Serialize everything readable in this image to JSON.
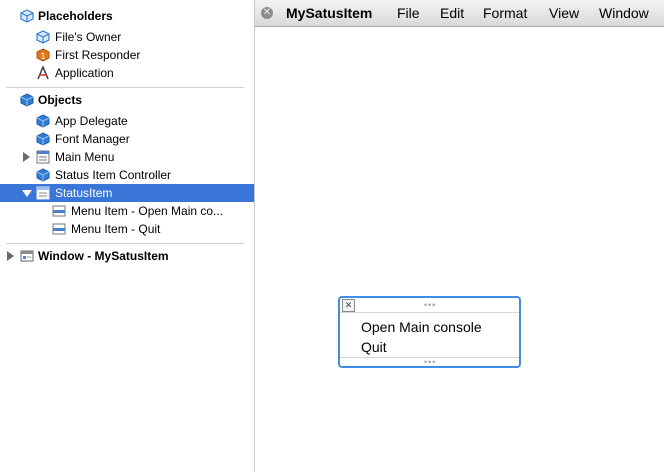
{
  "placeholders": {
    "header": "Placeholders",
    "items": [
      {
        "label": "File's Owner",
        "icon": "cube-outline-icon"
      },
      {
        "label": "First Responder",
        "icon": "first-responder-icon"
      },
      {
        "label": "Application",
        "icon": "application-icon"
      }
    ]
  },
  "objects": {
    "header": "Objects",
    "items": [
      {
        "label": "App Delegate",
        "icon": "blue-cube-icon"
      },
      {
        "label": "Font Manager",
        "icon": "blue-cube-icon"
      },
      {
        "label": "Main Menu",
        "icon": "menu-icon"
      },
      {
        "label": "Status Item Controller",
        "icon": "blue-cube-icon"
      },
      {
        "label": "StatusItem",
        "icon": "menu-icon",
        "selected": true
      },
      {
        "label": "Menu Item - Open Main co...",
        "icon": "menu-item-icon"
      },
      {
        "label": "Menu Item - Quit",
        "icon": "menu-item-icon"
      }
    ]
  },
  "window_row": {
    "label": "Window - MySatusItem",
    "icon": "window-icon"
  },
  "menubar": {
    "title": "MySatusItem",
    "items": [
      "File",
      "Edit",
      "Format",
      "View",
      "Window"
    ]
  },
  "status_menu": {
    "items": [
      "Open Main console",
      "Quit"
    ]
  },
  "colors": {
    "selection": "#3a75d8",
    "menu_border": "#3f8ee4",
    "cube_blue": "#2f7fd8",
    "responder_orange": "#e07a1f"
  }
}
